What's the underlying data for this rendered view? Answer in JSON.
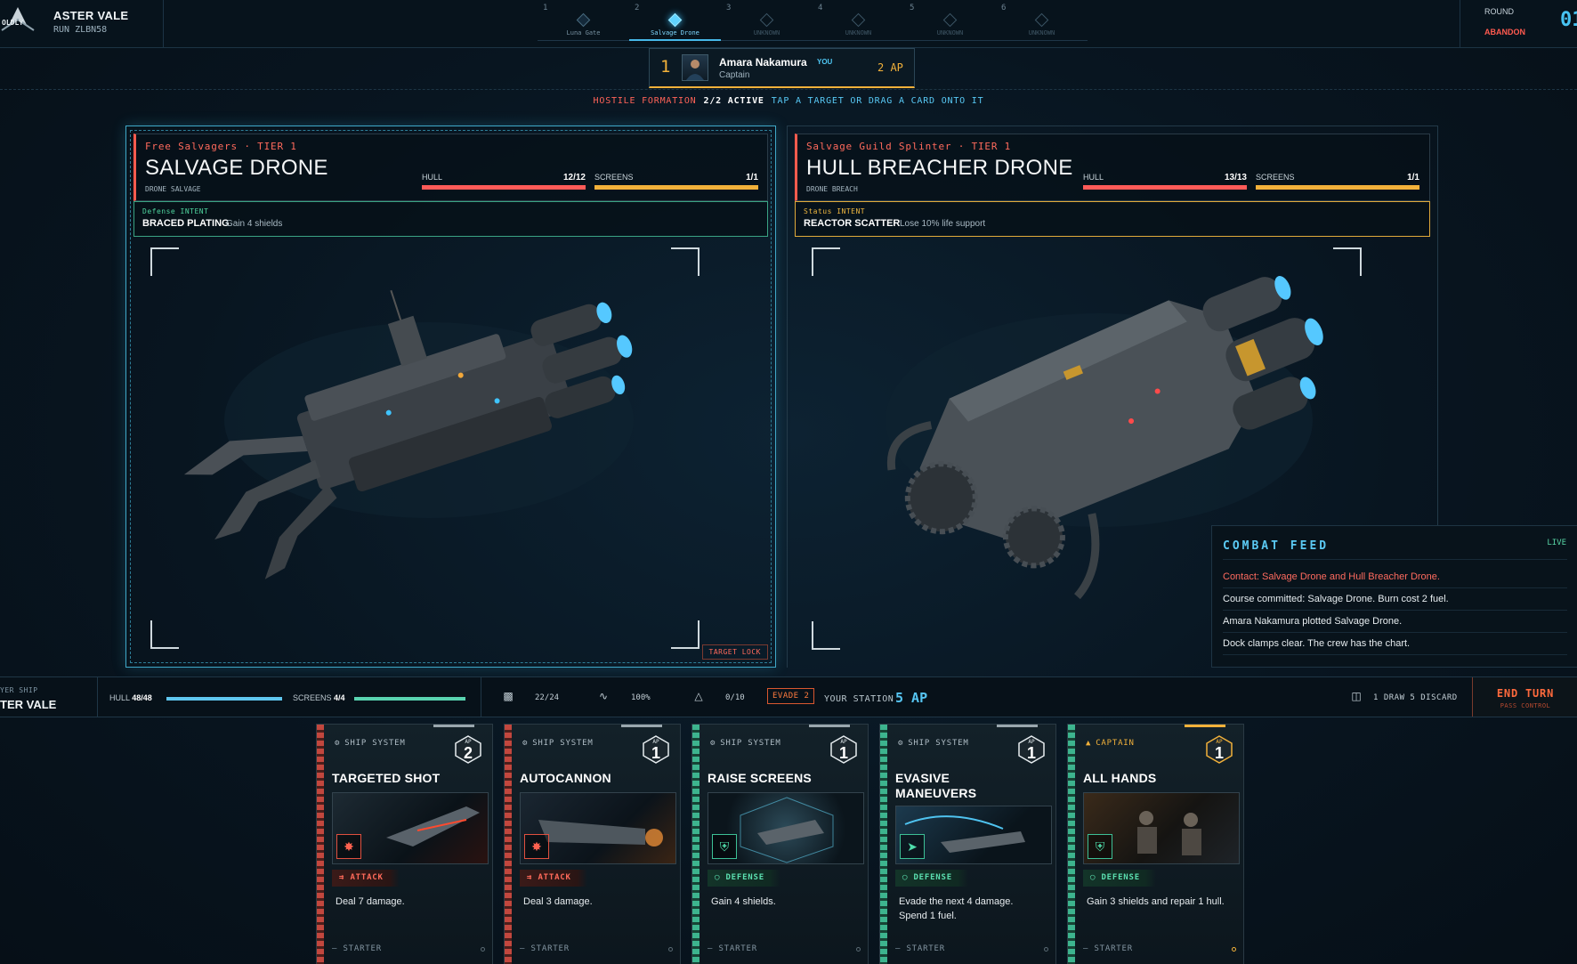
{
  "brand": {
    "logo_text": "OLDLY",
    "name": "ASTER VALE",
    "run": "RUN ZLBN58"
  },
  "route": {
    "steps": [
      {
        "num": "1",
        "label": "Luna Gate",
        "state": "done"
      },
      {
        "num": "2",
        "label": "Salvage Drone",
        "state": "active"
      },
      {
        "num": "3",
        "label": "UNKNOWN",
        "state": "locked"
      },
      {
        "num": "4",
        "label": "UNKNOWN",
        "state": "locked"
      },
      {
        "num": "5",
        "label": "UNKNOWN",
        "state": "locked"
      },
      {
        "num": "6",
        "label": "UNKNOWN",
        "state": "locked"
      }
    ]
  },
  "round": {
    "label": "ROUND",
    "value": "01",
    "abandon": "ABANDON"
  },
  "captain": {
    "order": "1",
    "name": "Amara Nakamura",
    "you": "YOU",
    "role": "Captain",
    "ap": "2 AP"
  },
  "formation": {
    "label": "HOSTILE FORMATION",
    "active": "2/2 ACTIVE",
    "hint": "TAP A TARGET OR DRAG A CARD ONTO IT"
  },
  "enemies": [
    {
      "faction": "Free Salvagers · TIER 1",
      "name": "SALVAGE DRONE",
      "tags": "DRONE SALVAGE",
      "hull_label": "HULL",
      "hull": "12/12",
      "hull_fraction": 1.0,
      "screens_label": "SCREENS",
      "screens": "1/1",
      "screens_fraction": 1.0,
      "intent_type": "Defense INTENT",
      "intent_name": "BRACED PLATING",
      "intent_desc": "Gain 4 shields",
      "target_lock": "TARGET LOCK"
    },
    {
      "faction": "Salvage Guild Splinter · TIER 1",
      "name": "HULL BREACHER DRONE",
      "tags": "DRONE BREACH",
      "hull_label": "HULL",
      "hull": "13/13",
      "hull_fraction": 1.0,
      "screens_label": "SCREENS",
      "screens": "1/1",
      "screens_fraction": 1.0,
      "intent_type": "Status INTENT",
      "intent_name": "REACTOR SCATTER",
      "intent_desc": "Lose 10% life support"
    }
  ],
  "feed": {
    "title": "COMBAT FEED",
    "live": "LIVE",
    "lines": [
      "Contact: Salvage Drone and Hull Breacher Drone.",
      "Course committed: Salvage Drone. Burn cost 2 fuel.",
      "Amara Nakamura plotted Salvage Drone.",
      "Dock clamps clear. The crew has the chart."
    ]
  },
  "status": {
    "ship_label": "YER SHIP",
    "ship_name": "TER VALE",
    "hull_label": "HULL",
    "hull": "48/48",
    "hull_fraction": 1.0,
    "screens_label": "SCREENS",
    "screens": "4/4",
    "screens_fraction": 1.0,
    "fuel": "22/24",
    "life_support": "100%",
    "alert": "0/10",
    "evade": "EVADE 2",
    "station_label": "YOUR STATION",
    "station_ap": "5 AP",
    "deck": "1 DRAW  5 DISCARD",
    "end_turn": "END TURN",
    "end_turn_sub": "PASS CONTROL"
  },
  "cards": [
    {
      "type": "SHIP SYSTEM",
      "ap_label": "AP",
      "cost": "2",
      "title": "TARGETED SHOT",
      "category": "ATTACK",
      "desc": "Deal 7 damage.",
      "footer": "STARTER",
      "kind": "atk"
    },
    {
      "type": "SHIP SYSTEM",
      "ap_label": "AP",
      "cost": "1",
      "title": "AUTOCANNON",
      "category": "ATTACK",
      "desc": "Deal 3 damage.",
      "footer": "STARTER",
      "kind": "atk"
    },
    {
      "type": "SHIP SYSTEM",
      "ap_label": "AP",
      "cost": "1",
      "title": "RAISE SCREENS",
      "category": "DEFENSE",
      "desc": "Gain 4 shields.",
      "footer": "STARTER",
      "kind": "def"
    },
    {
      "type": "SHIP SYSTEM",
      "ap_label": "AP",
      "cost": "1",
      "title": "EVASIVE MANEUVERS",
      "category": "DEFENSE",
      "desc": "Evade the next 4 damage. Spend 1 fuel.",
      "footer": "STARTER",
      "kind": "def"
    },
    {
      "type": "CAPTAIN",
      "ap_label": "AP",
      "cost": "1",
      "title": "ALL HANDS",
      "category": "DEFENSE",
      "desc": "Gain 3 shields and repair 1 hull.",
      "footer": "STARTER",
      "kind": "def"
    }
  ],
  "colors": {
    "accent": "#56c5f2",
    "hull": "#ff5b58",
    "screens": "#f2b13a",
    "attack": "#ff6250",
    "defense": "#3dc096",
    "alert": "#ff6a3d"
  }
}
